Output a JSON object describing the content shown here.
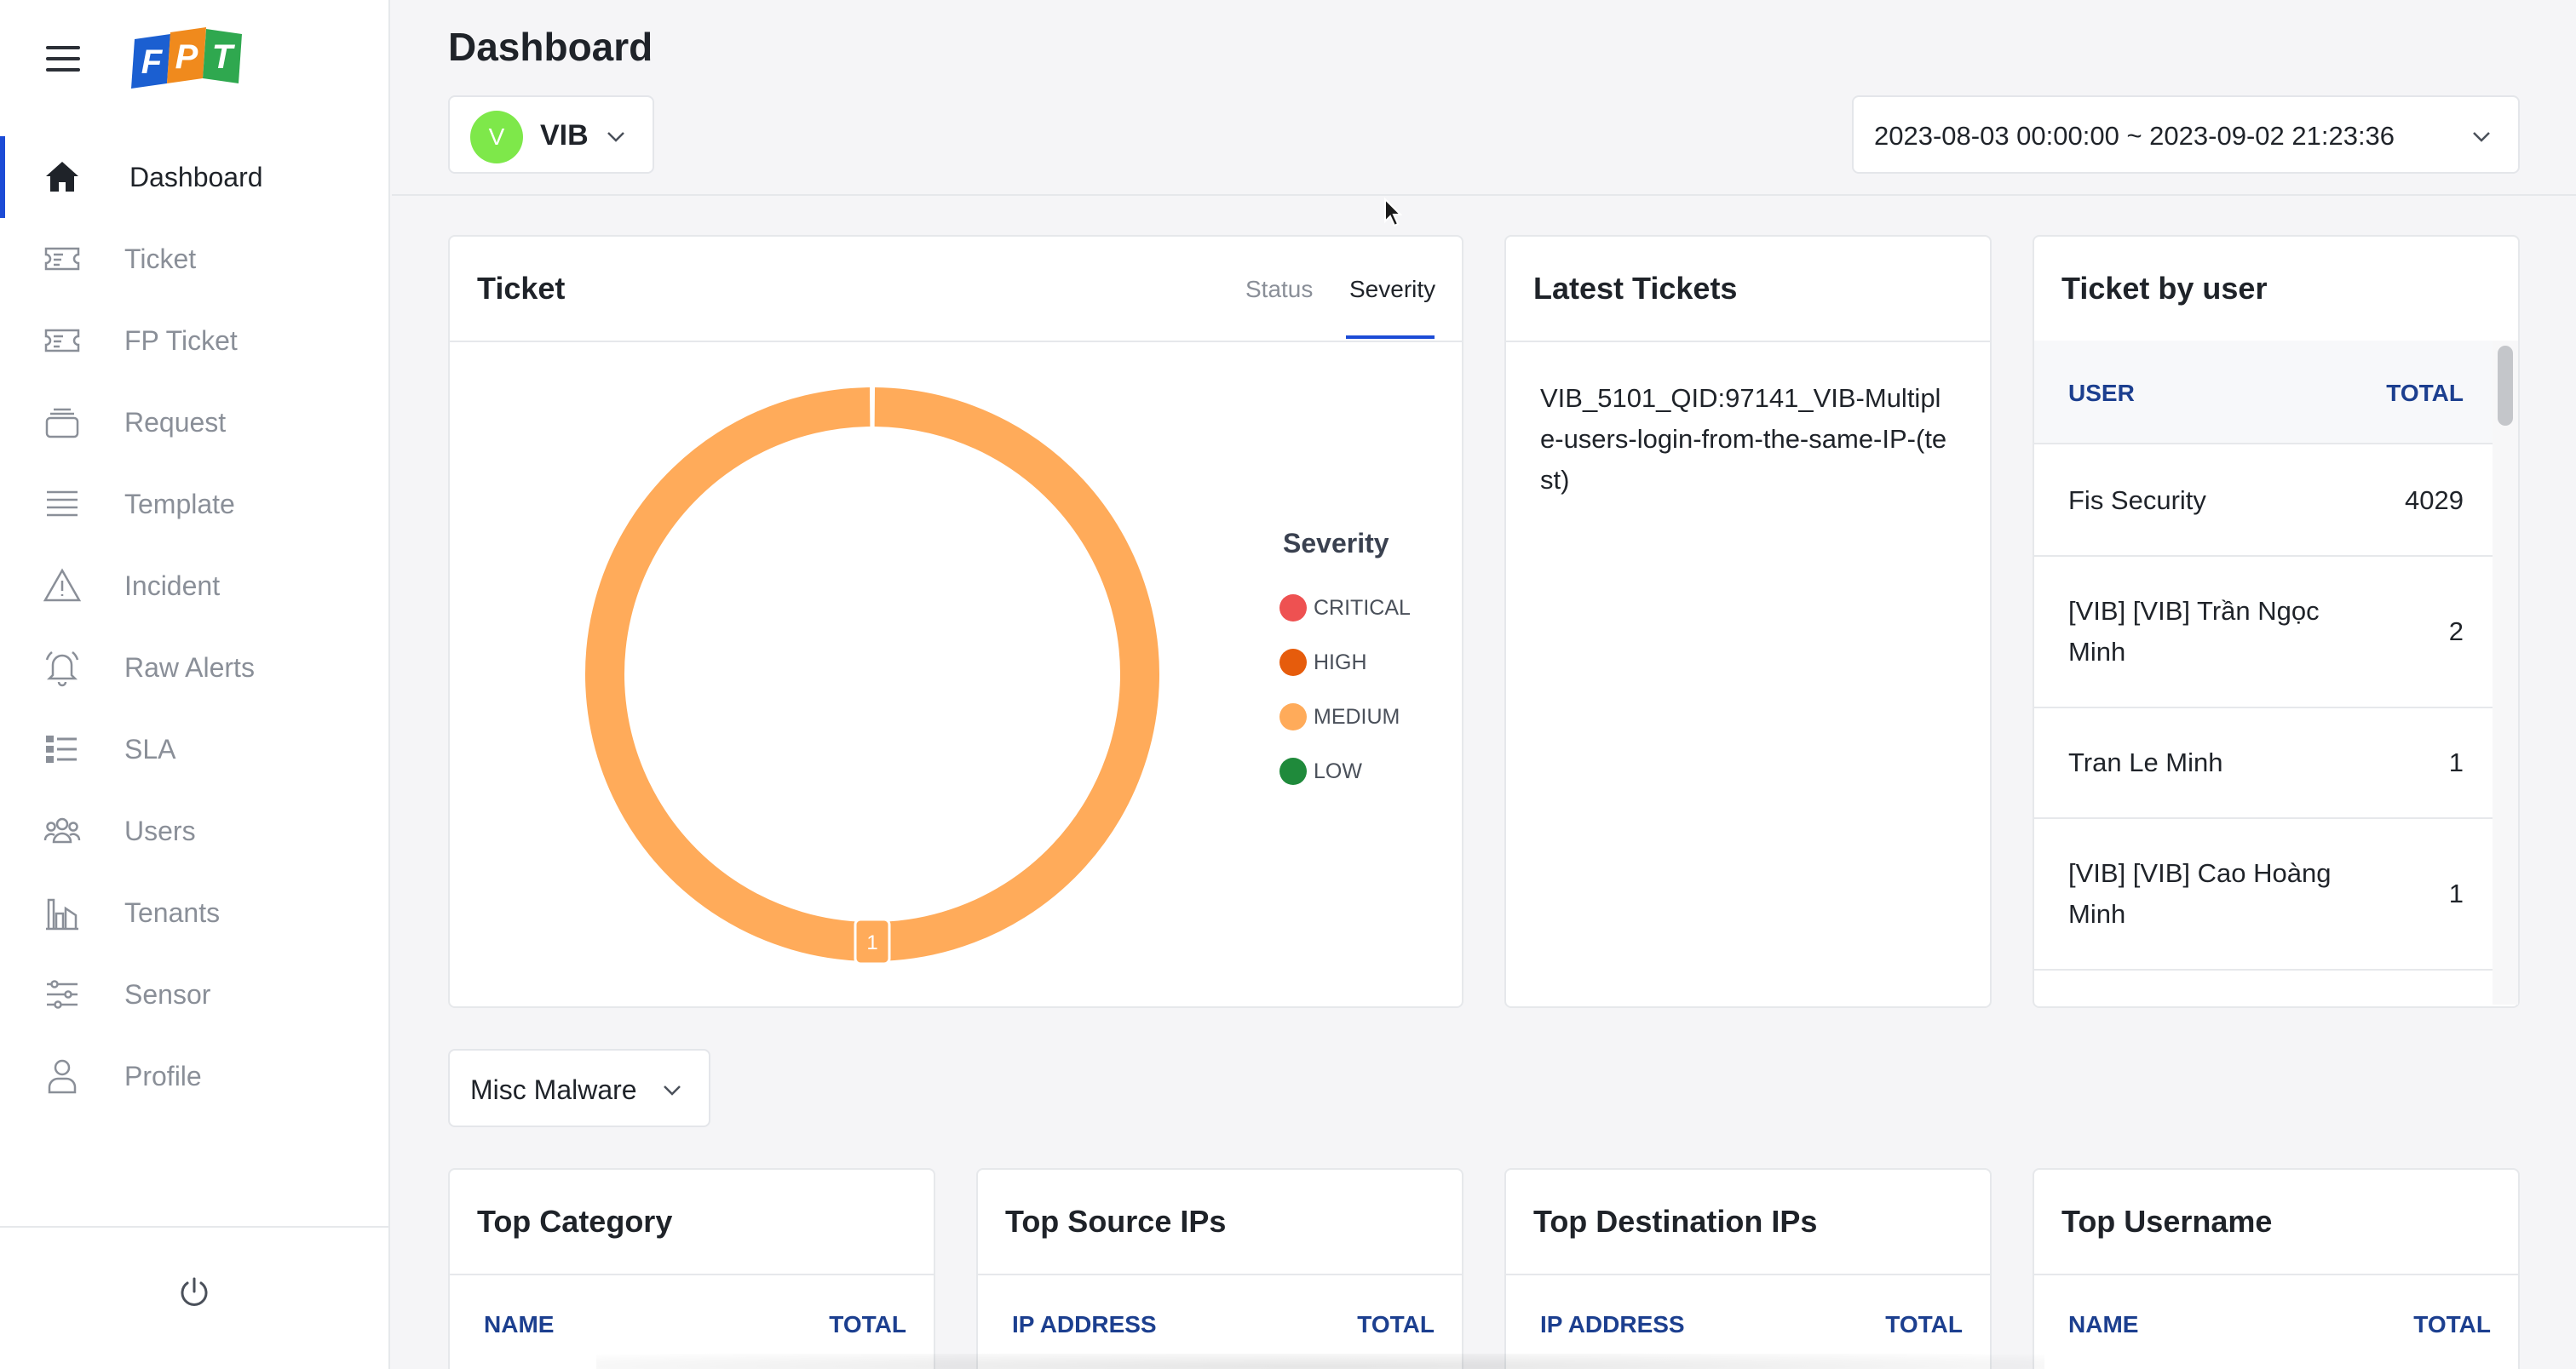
{
  "brand": {
    "logo_text": [
      "F",
      "P",
      "T"
    ]
  },
  "sidebar": {
    "items": [
      {
        "label": "Dashboard",
        "icon": "home-icon",
        "active": true
      },
      {
        "label": "Ticket",
        "icon": "ticket-icon"
      },
      {
        "label": "FP Ticket",
        "icon": "ticket-icon"
      },
      {
        "label": "Request",
        "icon": "stack-icon"
      },
      {
        "label": "Template",
        "icon": "list-icon"
      },
      {
        "label": "Incident",
        "icon": "warning-icon"
      },
      {
        "label": "Raw Alerts",
        "icon": "bell-icon"
      },
      {
        "label": "SLA",
        "icon": "checklist-icon"
      },
      {
        "label": "Users",
        "icon": "users-icon"
      },
      {
        "label": "Tenants",
        "icon": "building-icon"
      },
      {
        "label": "Sensor",
        "icon": "sliders-icon"
      },
      {
        "label": "Profile",
        "icon": "user-icon"
      }
    ]
  },
  "header": {
    "title": "Dashboard",
    "tenant": {
      "avatar_letter": "V",
      "name": "VIB"
    },
    "date_range": "2023-08-03 00:00:00 ~ 2023-09-02 21:23:36"
  },
  "ticket_card": {
    "title": "Ticket",
    "tabs": [
      {
        "label": "Status"
      },
      {
        "label": "Severity",
        "active": true
      }
    ],
    "legend_title": "Severity"
  },
  "chart_data": {
    "type": "pie",
    "categories": [
      "CRITICAL",
      "HIGH",
      "MEDIUM",
      "LOW"
    ],
    "values": [
      0,
      0,
      1,
      0
    ],
    "colors": [
      "#ee5151",
      "#e65c0c",
      "#ffab5a",
      "#1f8a3b"
    ],
    "data_labels": [
      "",
      "",
      "1",
      ""
    ],
    "legend": "right"
  },
  "latest_tickets": {
    "title": "Latest Tickets",
    "items": [
      "VIB_5101_QID:97141_VIB-Multiple-users-login-from-the-same-IP-(test)"
    ]
  },
  "ticket_by_user": {
    "title": "Ticket by user",
    "columns": {
      "user": "USER",
      "total": "TOTAL"
    },
    "rows": [
      {
        "name": "Fis Security",
        "total": "4029"
      },
      {
        "name": "[VIB] [VIB] Trần Ngọc Minh",
        "total": "2"
      },
      {
        "name": "Tran Le Minh",
        "total": "1"
      },
      {
        "name": "[VIB] [VIB] Cao Hoàng Minh",
        "total": "1"
      }
    ]
  },
  "category_filter": "Misc Malware",
  "bottom_cards": [
    {
      "title": "Top Category",
      "col1": "NAME",
      "col2": "TOTAL"
    },
    {
      "title": "Top Source IPs",
      "col1": "IP ADDRESS",
      "col2": "TOTAL"
    },
    {
      "title": "Top Destination IPs",
      "col1": "IP ADDRESS",
      "col2": "TOTAL"
    },
    {
      "title": "Top Username",
      "col1": "NAME",
      "col2": "TOTAL"
    }
  ]
}
